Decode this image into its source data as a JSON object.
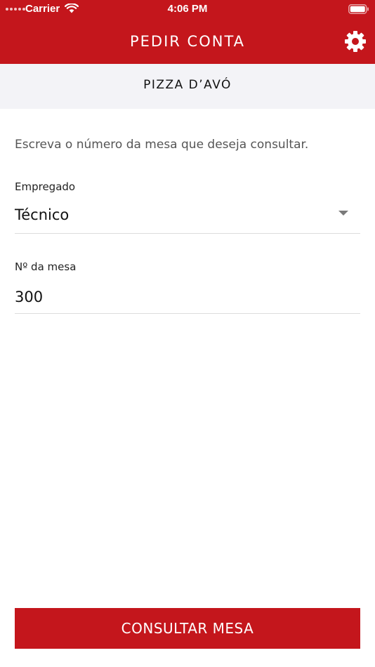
{
  "status_bar": {
    "carrier": "Carrier",
    "time": "4:06 PM"
  },
  "header": {
    "title": "PEDIR CONTA",
    "settings_icon": "gear-icon"
  },
  "restaurant": {
    "name": "PIZZA D’AVÓ"
  },
  "form": {
    "instructions": "Escreva o número da mesa que deseja consultar.",
    "employee_label": "Empregado",
    "employee_value": "Técnico",
    "table_label": "Nº da mesa",
    "table_value": "300",
    "submit_label": "CONSULTAR MESA"
  },
  "colors": {
    "brand": "#c4161c",
    "subheader_bg": "#f3f3f7"
  }
}
